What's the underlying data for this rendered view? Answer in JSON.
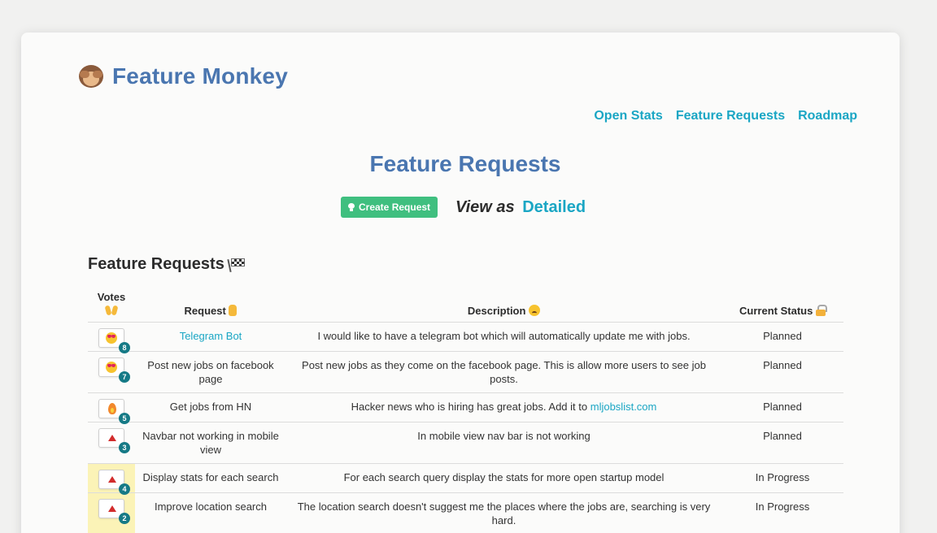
{
  "brand": {
    "title": "Feature Monkey",
    "logo_icon": "monkey-see-no-evil-icon"
  },
  "nav": {
    "items": [
      "Open Stats",
      "Feature Requests",
      "Roadmap"
    ]
  },
  "page": {
    "title": "Feature Requests"
  },
  "actions": {
    "create_label": "Create Request",
    "view_as_label": "View as",
    "view_mode": "Detailed"
  },
  "section": {
    "title": "Feature Requests",
    "icon": "checkered-flag-icon"
  },
  "table": {
    "headers": {
      "votes": "Votes",
      "request": "Request",
      "description": "Description",
      "status": "Current Status"
    },
    "header_icons": {
      "votes": "raising-hands-icon",
      "request": "crossed-fingers-icon",
      "description": "worried-face-icon",
      "status": "lock-icon"
    },
    "rows": [
      {
        "emoji": "heart-eyes",
        "votes": "8",
        "request": "Telegram Bot",
        "request_is_link": true,
        "description": "I would like to have a telegram bot which will automatically update me with jobs.",
        "status": "Planned",
        "highlight": false
      },
      {
        "emoji": "heart-eyes",
        "votes": "7",
        "request": "Post new jobs on facebook page",
        "description": "Post new jobs as they come on the facebook page. This is allow more users to see job posts.",
        "status": "Planned",
        "highlight": false
      },
      {
        "emoji": "fire",
        "votes": "5",
        "request": "Get jobs from HN",
        "description": "Hacker news who is hiring has great jobs. Add it to",
        "description_link": "mljobslist.com",
        "status": "Planned",
        "highlight": false
      },
      {
        "emoji": "up-arrow",
        "votes": "3",
        "request": "Navbar not working in mobile view",
        "description": "In mobile view nav bar is not working",
        "status": "Planned",
        "highlight": false
      },
      {
        "emoji": "up-arrow",
        "votes": "4",
        "request": "Display stats for each search",
        "description": "For each search query display the stats for more open startup model",
        "status": "In Progress",
        "highlight": true
      },
      {
        "emoji": "up-arrow",
        "votes": "2",
        "request": "Improve location search",
        "description": "The location search doesn't suggest me the places where the jobs are, searching is very hard.",
        "status": "In Progress",
        "highlight": true
      }
    ]
  },
  "colors": {
    "brand_blue": "#4a76b0",
    "link_teal": "#1aa6c4",
    "button_green": "#3fbf7f",
    "vote_badge": "#167a86",
    "highlight_yellow": "#fbf3b7"
  }
}
